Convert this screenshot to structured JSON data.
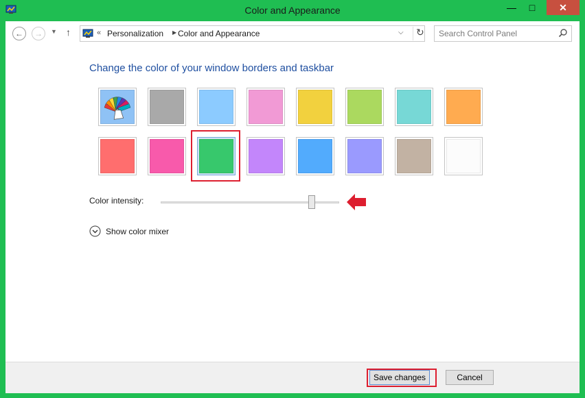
{
  "window": {
    "title": "Color and Appearance",
    "close_glyph": "✕",
    "min_glyph": "—",
    "max_glyph": "□",
    "app_icon": "control-panel-icon",
    "frame_color": "#1fbe52"
  },
  "navbar": {
    "back_glyph": "←",
    "forward_glyph": "→",
    "recent_glyph": "▼",
    "up_glyph": "↑",
    "address_prefix": "«",
    "breadcrumbs": [
      "Personalization",
      "Color and Appearance"
    ],
    "breadcrumb_separator": "▶",
    "dropdown_glyph": "⌵",
    "refresh_glyph": "↻",
    "search_placeholder": "Search Control Panel"
  },
  "heading": "Change the color of your window borders and taskbar",
  "swatches": [
    {
      "color": "automatic",
      "icon": "color-palette-icon"
    },
    {
      "color": "#a9a9a9"
    },
    {
      "color": "#8ccbff"
    },
    {
      "color": "#f19ad5"
    },
    {
      "color": "#f2d13e"
    },
    {
      "color": "#abd95f"
    },
    {
      "color": "#77d8d6"
    },
    {
      "color": "#ffab50"
    },
    {
      "color": "#ff6e6e"
    },
    {
      "color": "#f85aab"
    },
    {
      "color": "#37c86c",
      "selected": true
    },
    {
      "color": "#c386fb"
    },
    {
      "color": "#52abfd"
    },
    {
      "color": "#9a9afe"
    },
    {
      "color": "#c2b2a3"
    },
    {
      "color": "#fcfcfc"
    }
  ],
  "intensity": {
    "label": "Color intensity:",
    "value": 0.86
  },
  "mixer": {
    "label": "Show color mixer",
    "expand_glyph": "⌄"
  },
  "footer": {
    "save_label": "Save changes",
    "cancel_label": "Cancel"
  },
  "annotation_color": "#dd1e2f"
}
